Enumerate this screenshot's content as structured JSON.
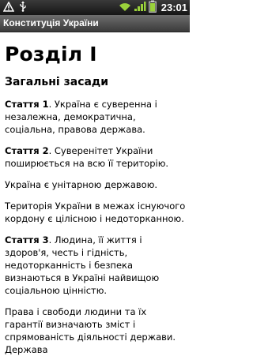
{
  "status_bar": {
    "time": "23:01",
    "left_icons": [
      "warning-icon",
      "usb-icon"
    ],
    "right_icons": [
      "wifi-icon",
      "signal-icon",
      "battery-icon"
    ]
  },
  "app": {
    "title": "Конституція України"
  },
  "content": {
    "section_title": "Розділ I",
    "subtitle": "Загальні засади",
    "paragraphs": [
      {
        "article": "Стаття 1",
        "text": ". Україна є суверенна і незалежна, демократична, соціальна, правова держава."
      },
      {
        "article": "Стаття 2",
        "text": ". Суверенітет України поширюється на всю її територію."
      },
      {
        "article": "",
        "text": "Україна є унітарною державою."
      },
      {
        "article": "",
        "text": "Територія України в межах існуючого кордону є цілісною і недоторканною."
      },
      {
        "article": "Стаття 3",
        "text": ". Людина, її життя і здоров'я, честь і гідність, недоторканність і безпека визнаються в Україні найвищою соціальною цінністю."
      },
      {
        "article": "",
        "text": "Права і свободи людини та їх гарантії визначають зміст і спрямованість діяльності держави. Держава"
      }
    ]
  }
}
